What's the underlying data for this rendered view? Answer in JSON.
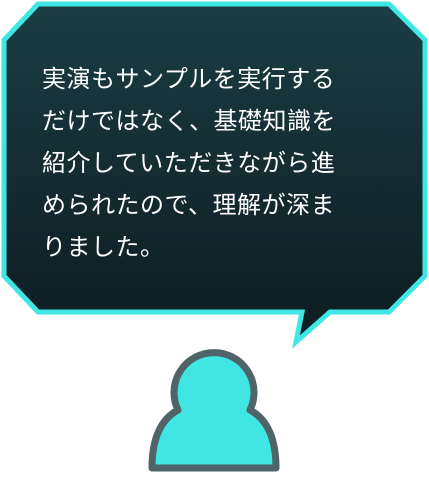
{
  "testimonial": {
    "quote": "実演もサンプルを実行する\nだけではなく、基礎知識を\n紹介していただきながら進\nめられたので、理解が深ま\nりました。"
  },
  "colors": {
    "bubble_fill_top": "#1a3d44",
    "bubble_fill_bottom": "#0d1c20",
    "bubble_stroke": "#3fe6e4",
    "avatar_fill": "#3fe6e4",
    "avatar_stroke": "#4f6468",
    "text": "#ffffff"
  },
  "icons": {
    "avatar": "person-silhouette-icon"
  }
}
